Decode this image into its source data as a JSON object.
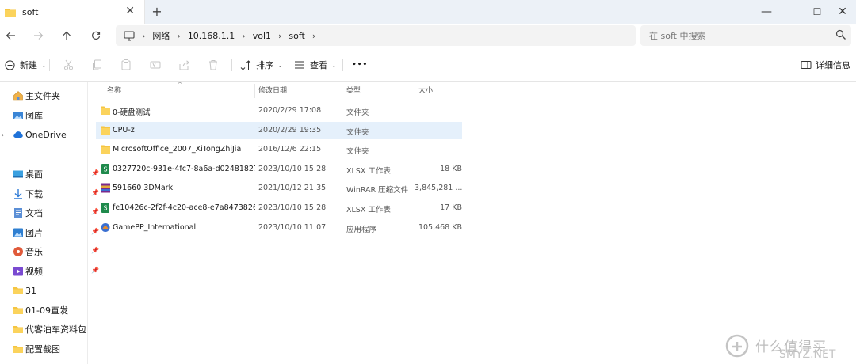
{
  "tab": {
    "title": "soft",
    "close": "✕",
    "new": "+"
  },
  "window": {
    "minimize": "—",
    "maximize": "☐",
    "close": "✕"
  },
  "breadcrumb": [
    "网络",
    "10.168.1.1",
    "vol1",
    "soft"
  ],
  "search": {
    "placeholder": "在 soft 中搜索"
  },
  "commands": {
    "new": "新建",
    "sort": "排序",
    "view": "查看",
    "more": "•••",
    "details": "详细信息"
  },
  "sidebar": {
    "top": [
      {
        "label": "主文件夹",
        "icon": "home-icon"
      },
      {
        "label": "图库",
        "icon": "gallery-icon"
      },
      {
        "label": "OneDrive",
        "icon": "cloud-icon"
      }
    ],
    "pinned": [
      {
        "label": "桌面",
        "icon": "desktop-icon"
      },
      {
        "label": "下载",
        "icon": "download-icon"
      },
      {
        "label": "文档",
        "icon": "document-icon"
      },
      {
        "label": "图片",
        "icon": "picture-icon"
      },
      {
        "label": "音乐",
        "icon": "music-icon"
      },
      {
        "label": "视频",
        "icon": "video-icon"
      }
    ],
    "folders": [
      {
        "label": "31"
      },
      {
        "label": "01-09直发"
      },
      {
        "label": "代客泊车资料包"
      },
      {
        "label": "配置截图"
      }
    ]
  },
  "columns": {
    "name": "名称",
    "date": "修改日期",
    "type": "类型",
    "size": "大小"
  },
  "files": [
    {
      "name": "0-硬盘测试",
      "date": "2020/2/29 17:08",
      "type": "文件夹",
      "size": "",
      "icon": "folder-icon"
    },
    {
      "name": "CPU-z",
      "date": "2020/2/29 19:35",
      "type": "文件夹",
      "size": "",
      "icon": "folder-icon",
      "selected": true
    },
    {
      "name": "MicrosoftOffice_2007_XiTongZhiJia",
      "date": "2016/12/6 22:15",
      "type": "文件夹",
      "size": "",
      "icon": "folder-icon"
    },
    {
      "name": "0327720c-931e-4fc7-8a6a-d02481827...",
      "date": "2023/10/10 15:28",
      "type": "XLSX 工作表",
      "size": "18 KB",
      "icon": "spreadsheet-icon"
    },
    {
      "name": "591660 3DMark",
      "date": "2021/10/12 21:35",
      "type": "WinRAR 压缩文件",
      "size": "3,845,281 ...",
      "icon": "archive-icon"
    },
    {
      "name": "fe10426c-2f2f-4c20-ace8-e7a8473826...",
      "date": "2023/10/10 15:28",
      "type": "XLSX 工作表",
      "size": "17 KB",
      "icon": "spreadsheet-icon"
    },
    {
      "name": "GamePP_International",
      "date": "2023/10/10 11:07",
      "type": "应用程序",
      "size": "105,468 KB",
      "icon": "application-icon"
    }
  ],
  "watermark": {
    "text": "什么值得买",
    "sub": "SMYZ.NET"
  },
  "colors": {
    "accent": "#0067c0",
    "selected_row": "#e5f0fb",
    "folder": "#f5c542",
    "tabbar": "#ecf1f7"
  }
}
